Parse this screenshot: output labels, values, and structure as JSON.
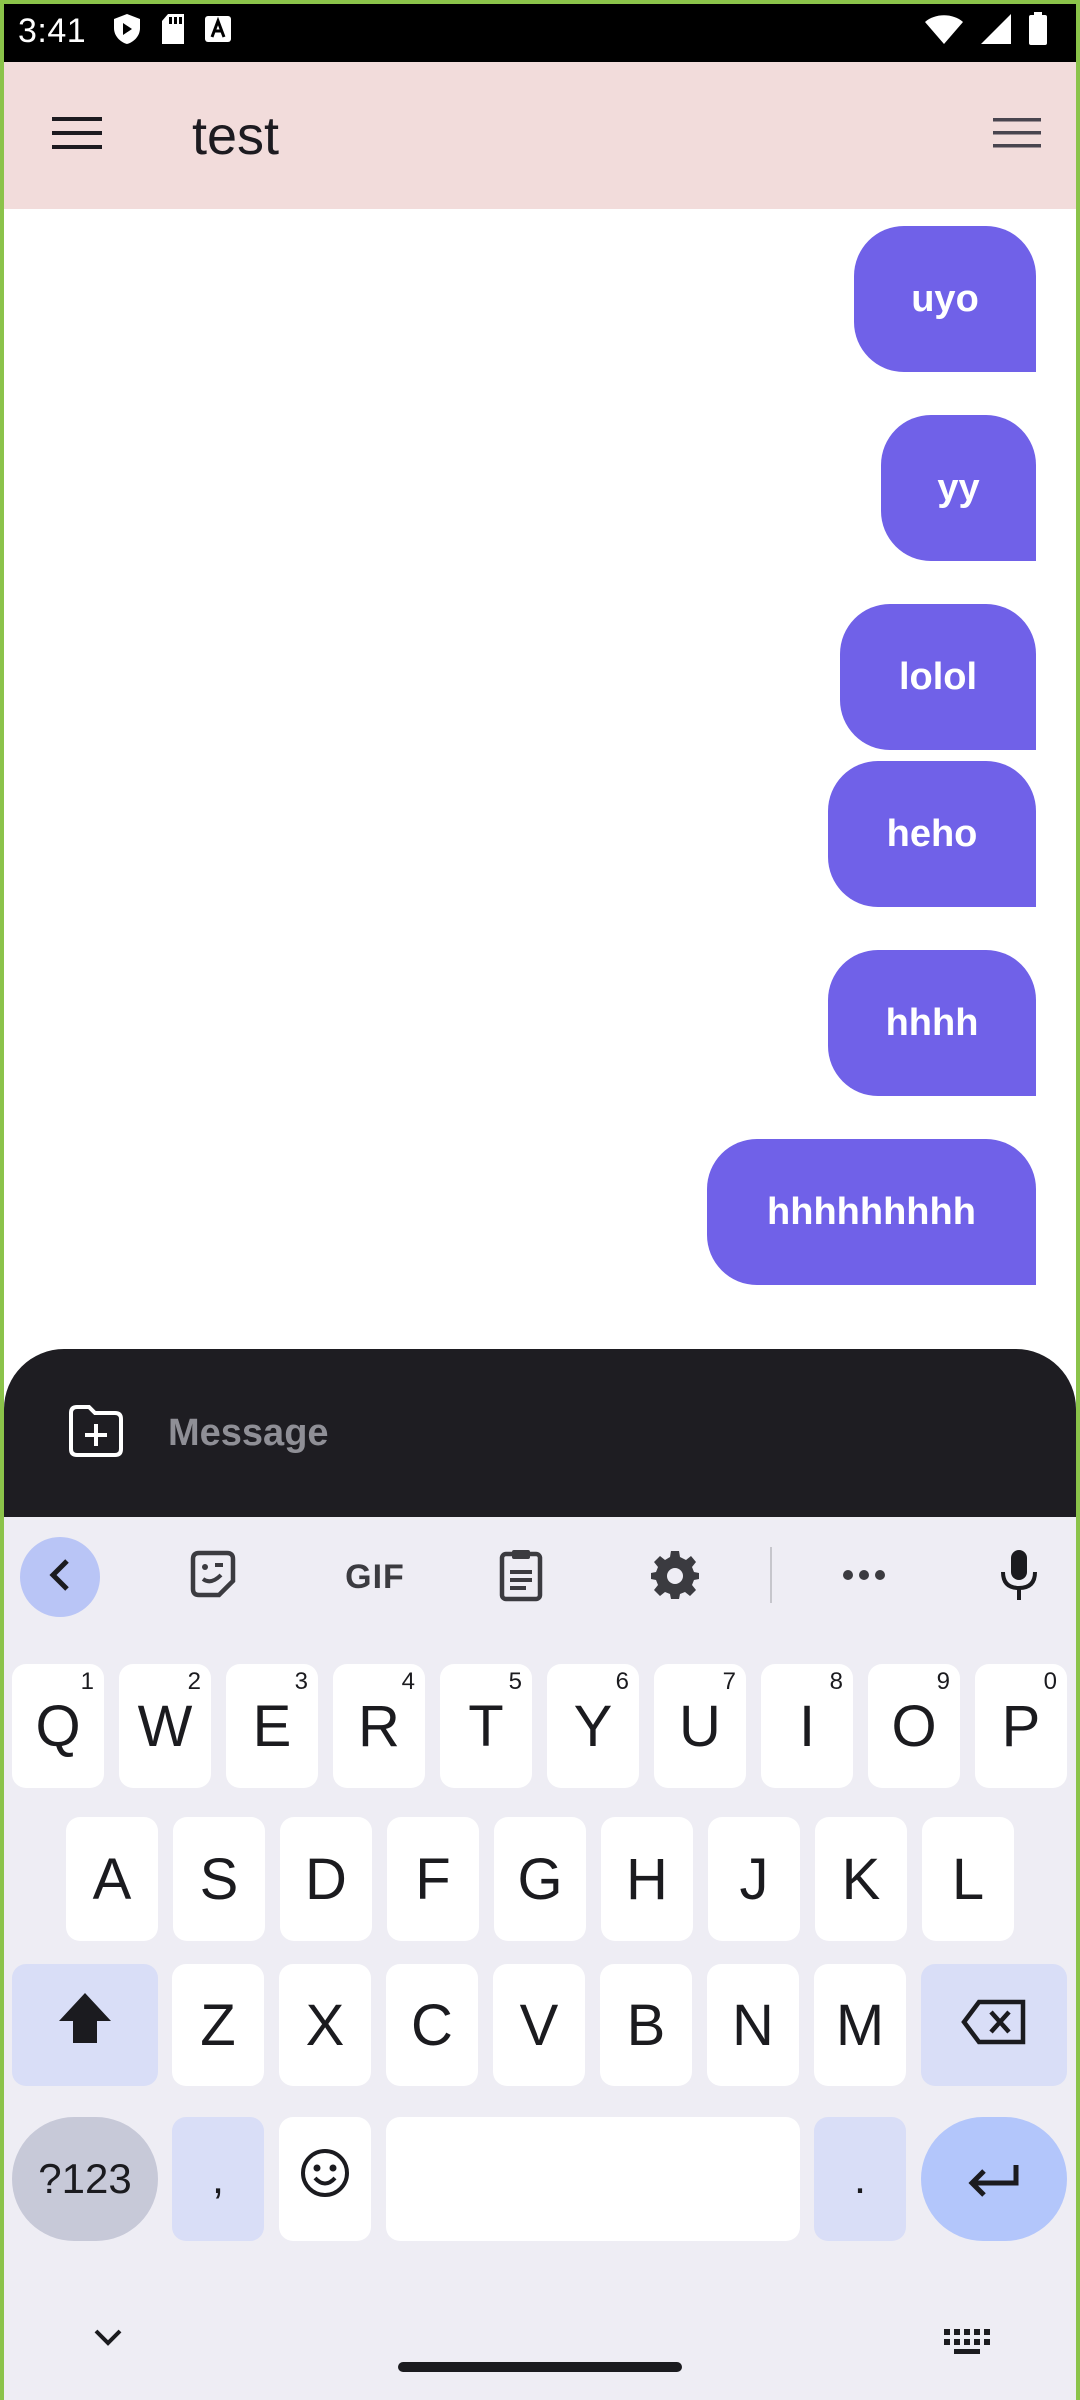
{
  "status_bar": {
    "time": "3:41",
    "icons": [
      "shield-icon",
      "sd-card-icon",
      "a-box-icon",
      "wifi-icon",
      "cell-signal-icon",
      "battery-icon"
    ]
  },
  "app_bar": {
    "title": "test",
    "left_icon": "menu-icon",
    "right_icon": "overflow-menu-icon",
    "background": "#f2dcdb"
  },
  "messages": [
    {
      "text": "uyo"
    },
    {
      "text": "yy"
    },
    {
      "text": "lolol"
    },
    {
      "text": "heho"
    },
    {
      "text": "hhhh"
    },
    {
      "text": "hhhhhhhhh"
    }
  ],
  "bubble_color": "#7061e8",
  "composer": {
    "placeholder": "Message",
    "attach_icon": "add-file-icon",
    "background": "#1e1d22"
  },
  "keyboard": {
    "toolbar": [
      "back-chevron-icon",
      "sticker-icon",
      "gif-icon",
      "clipboard-icon",
      "settings-icon",
      "more-icon",
      "microphone-icon"
    ],
    "gif_label": "GIF",
    "row1": [
      {
        "key": "Q",
        "hint": "1"
      },
      {
        "key": "W",
        "hint": "2"
      },
      {
        "key": "E",
        "hint": "3"
      },
      {
        "key": "R",
        "hint": "4"
      },
      {
        "key": "T",
        "hint": "5"
      },
      {
        "key": "Y",
        "hint": "6"
      },
      {
        "key": "U",
        "hint": "7"
      },
      {
        "key": "I",
        "hint": "8"
      },
      {
        "key": "O",
        "hint": "9"
      },
      {
        "key": "P",
        "hint": "0"
      }
    ],
    "row2": [
      "A",
      "S",
      "D",
      "F",
      "G",
      "H",
      "J",
      "K",
      "L"
    ],
    "row3": [
      "Z",
      "X",
      "C",
      "V",
      "B",
      "N",
      "M"
    ],
    "symbols_label": "?123",
    "comma_label": ",",
    "period_label": ".",
    "nav": [
      "hide-keyboard-icon",
      "keyboard-switch-icon"
    ]
  }
}
